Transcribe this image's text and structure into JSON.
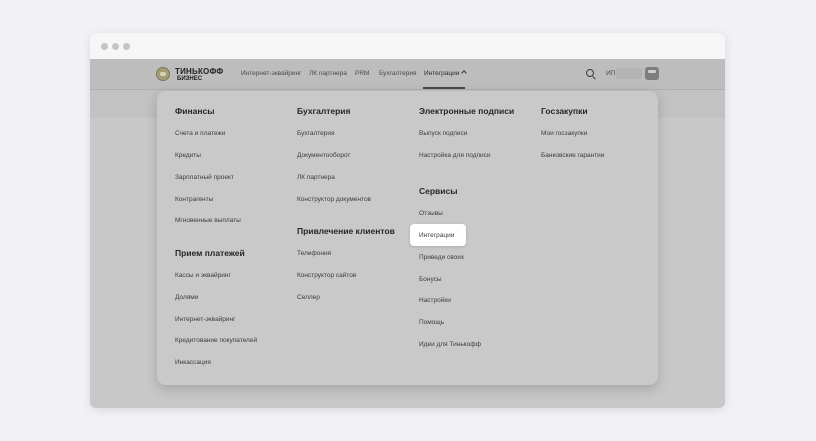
{
  "header": {
    "logo": {
      "line1": "ТИНЬКОФФ",
      "line2": "БИЗНЕС"
    },
    "nav": [
      "Интернет-эквайринг",
      "ЛК партнера",
      "PRM",
      "Бухгалтерия",
      "Интеграции"
    ],
    "user_prefix": "ИП"
  },
  "menu": {
    "finance": {
      "title": "Финансы",
      "items": [
        "Счета и платежи",
        "Кредиты",
        "Зарплатный проект",
        "Контрагенты",
        "Мгновенные выплаты"
      ]
    },
    "payments": {
      "title": "Прием платежей",
      "items": [
        "Кассы и эквайринг",
        "Долями",
        "Интернет-эквайринг",
        "Кредитование покупателей",
        "Инкассация"
      ]
    },
    "accounting": {
      "title": "Бухгалтерия",
      "items": [
        "Бухгалтерия",
        "Документооборот",
        "ЛК партнера",
        "Конструктор документов"
      ]
    },
    "clients": {
      "title": "Привлечение клиентов",
      "items": [
        "Телефония",
        "Конструктор сайтов",
        "Селлер"
      ]
    },
    "signatures": {
      "title": "Электронные подписи",
      "items": [
        "Выпуск подписи",
        "Настройка для подписи"
      ]
    },
    "services": {
      "title": "Сервисы",
      "items": [
        "Отзывы",
        "Интеграции",
        "Приведи своих",
        "Бонусы",
        "Настройки",
        "Помощь",
        "Идеи для Тинькофф"
      ]
    },
    "procurement": {
      "title": "Госзакупки",
      "items": [
        "Мои госзакупки",
        "Банковские гарантии"
      ]
    }
  },
  "colors": {
    "page_bg": "#f2f2f6",
    "overlay": "#c8c8c8",
    "highlight": "#ffffff"
  },
  "icons": [
    "search-icon",
    "chevron-up-icon",
    "avatar"
  ]
}
